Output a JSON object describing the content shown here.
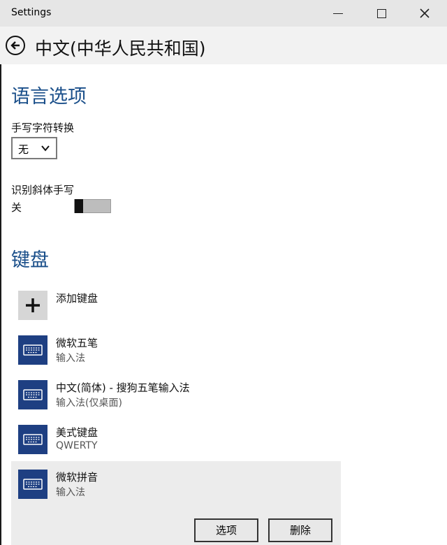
{
  "window": {
    "title": "Settings"
  },
  "header": {
    "title": "中文(中华人民共和国)"
  },
  "language_options": {
    "heading": "语言选项",
    "handwriting_conversion": {
      "label": "手写字符转换",
      "selected": "无"
    },
    "italic_handwriting": {
      "label": "识别斜体手写",
      "state_label": "关",
      "on": false
    }
  },
  "keyboards": {
    "heading": "键盘",
    "add_label": "添加键盘",
    "items": [
      {
        "name": "微软五笔",
        "subtitle": "输入法"
      },
      {
        "name": "中文(简体) - 搜狗五笔输入法",
        "subtitle": "输入法(仅桌面)"
      },
      {
        "name": "美式键盘",
        "subtitle": "QWERTY"
      },
      {
        "name": "微软拼音",
        "subtitle": "输入法"
      }
    ],
    "options_button": "选项",
    "remove_button": "删除"
  },
  "colors": {
    "accent": "#1a4f8a",
    "tile": "#1e3f82"
  },
  "icons": [
    "back-arrow-icon",
    "minimize-icon",
    "maximize-icon",
    "close-icon",
    "chevron-down-icon",
    "plus-icon",
    "keyboard-icon"
  ]
}
